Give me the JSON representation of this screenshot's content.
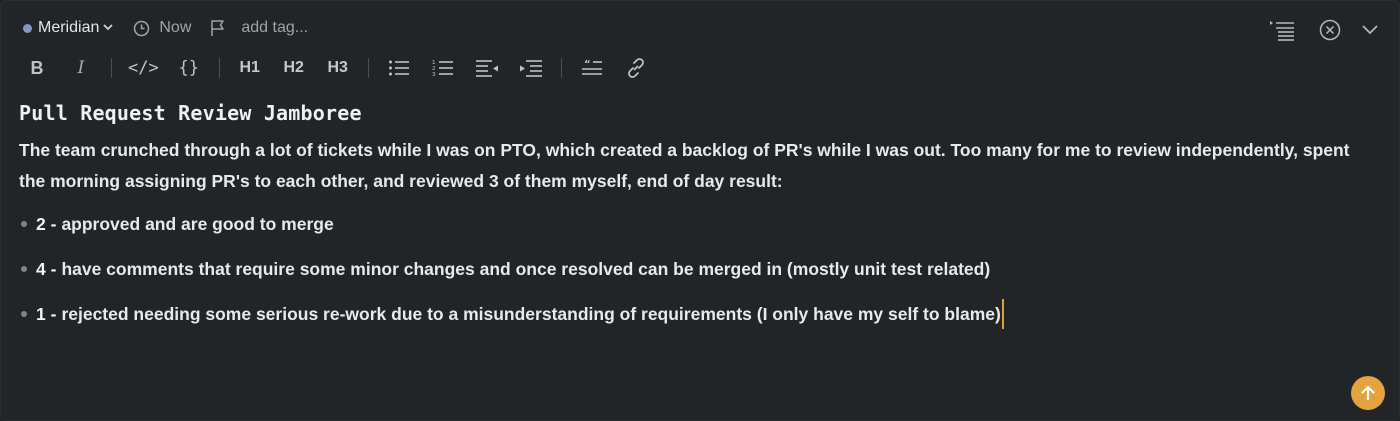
{
  "meta": {
    "project": "Meridian",
    "time": "Now",
    "tag_placeholder": "add tag..."
  },
  "toolbar": {
    "bold": "B",
    "italic": "I",
    "code": "</>",
    "code_block": "{}",
    "h1": "H1",
    "h2": "H2",
    "h3": "H3"
  },
  "note": {
    "title": "Pull Request Review Jamboree",
    "paragraph": "The team crunched through a lot of tickets while I was on PTO, which created a backlog of PR's while I was out. Too many for me to review independently, spent the morning assigning PR's to each other, and reviewed 3 of them myself, end of day result:",
    "bullets": [
      {
        "num": "2 -",
        "text": "approved and are good to merge"
      },
      {
        "num": "4 -",
        "text": "have comments that require some minor changes and once resolved can be merged in (mostly unit test related)"
      },
      {
        "num": "1 -",
        "text": "rejected needing some serious re-work due to a misunderstanding of requirements (I only have my self to blame)"
      }
    ]
  },
  "colors": {
    "background": "#212527",
    "accent": "#e3a341",
    "project_dot": "#8a93c4"
  },
  "icons": {
    "clock": "clock-icon",
    "flag": "flag-icon",
    "outline": "outline-icon",
    "close": "close-circle-icon",
    "collapse": "chevron-down-icon",
    "scroll_top": "arrow-up-icon"
  }
}
